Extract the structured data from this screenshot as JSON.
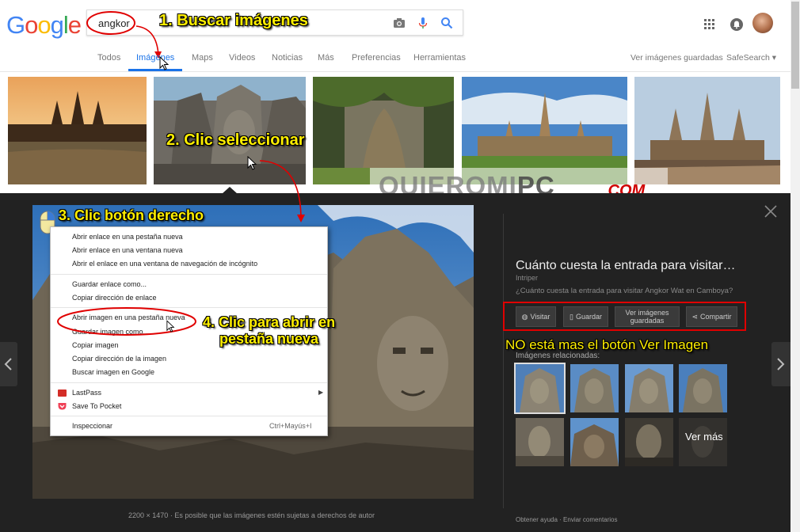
{
  "colors": {
    "accent": "#1a73e8",
    "annotation": "#ffef00",
    "red": "#e00000",
    "dark_bg": "#222222"
  },
  "logo": {
    "letters": [
      "G",
      "o",
      "o",
      "g",
      "l",
      "e"
    ],
    "colors": [
      "#4285f4",
      "#ea4335",
      "#fbbc05",
      "#4285f4",
      "#34a853",
      "#ea4335"
    ]
  },
  "search": {
    "value": "angkor"
  },
  "icons": {
    "camera": "camera-icon",
    "mic": "mic-icon",
    "search": "search-icon",
    "apps": "apps-grid-icon",
    "notifications": "notifications-icon",
    "avatar": "avatar"
  },
  "tabs": [
    "Todos",
    "Imágenes",
    "Maps",
    "Videos",
    "Noticias",
    "Más",
    "Preferencias",
    "Herramientas"
  ],
  "active_tab": "Imágenes",
  "right_links": {
    "saved": "Ver imágenes guardadas",
    "safesearch": "SafeSearch ▾"
  },
  "annotations": {
    "step1": "1. Buscar imágenes",
    "step2": "2. Clic seleccionar",
    "step3": "3. Clic botón derecho",
    "step4_line1": "4. Clic para abrir en",
    "step4_line2": "pestaña nueva",
    "note": "NO está mas el botón Ver Imagen"
  },
  "watermark": {
    "main": "QUIEROMI",
    "pc": "PC",
    "com": ".COM"
  },
  "context_menu": {
    "group1": [
      "Abrir enlace en una pestaña nueva",
      "Abrir enlace en una ventana nueva",
      "Abrir el enlace en una ventana de navegación de incógnito"
    ],
    "group2": [
      "Guardar enlace como...",
      "Copiar dirección de enlace"
    ],
    "group3": [
      "Abrir imagen en una pestaña nueva",
      "Guardar imagen como...",
      "Copiar imagen",
      "Copiar dirección de la imagen",
      "Buscar imagen en Google"
    ],
    "group4": [
      "LastPass",
      "Save To Pocket"
    ],
    "inspect": "Inspeccionar",
    "inspect_shortcut": "Ctrl+Mayús+I"
  },
  "image_caption": {
    "size": "2200 × 1470",
    "notice": "Es posible que las imágenes estén sujetas a derechos de autor"
  },
  "right_panel": {
    "title": "Cuánto cuesta la entrada para visitar…",
    "source": "Intriper",
    "description": "¿Cuánto cuesta la entrada para visitar Angkor Wat en Camboya?",
    "buttons": [
      "Visitar",
      "Guardar",
      "Ver imágenes guardadas",
      "Compartir"
    ],
    "related_label": "Imágenes relacionadas:",
    "see_more": "Ver más",
    "footer": "Obtener ayuda  ·  Enviar comentarios"
  }
}
